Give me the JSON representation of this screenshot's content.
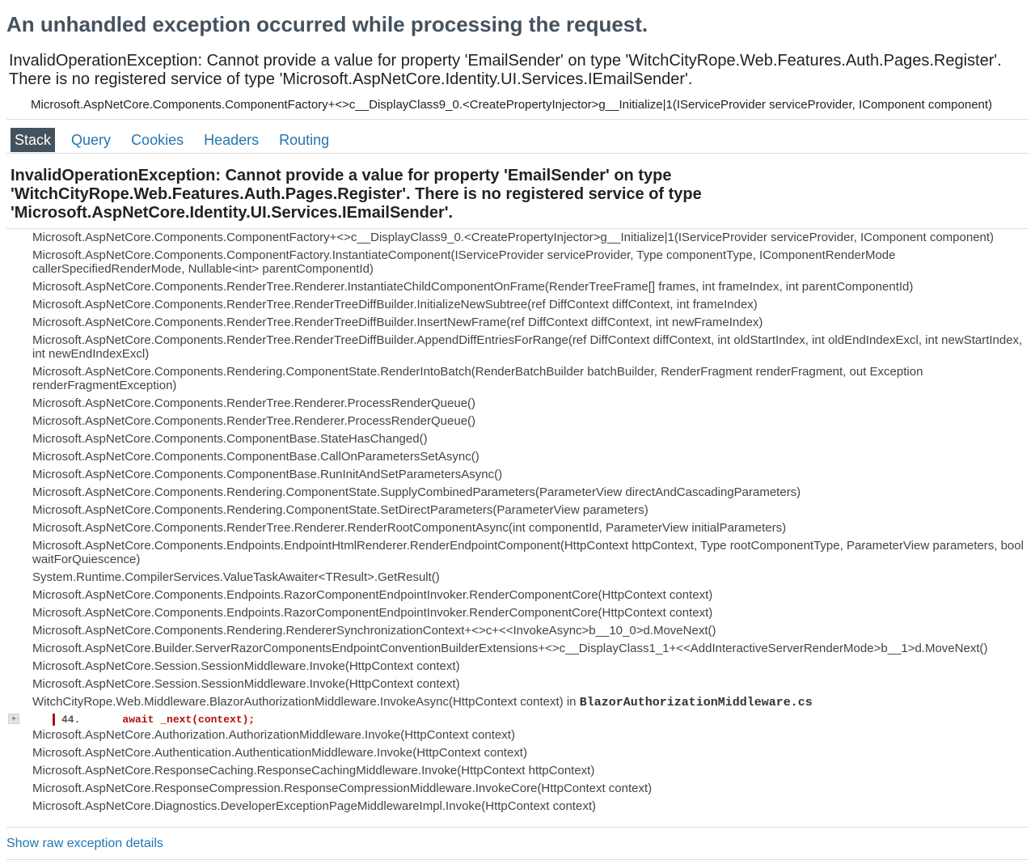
{
  "page_title": "An unhandled exception occurred while processing the request.",
  "error": {
    "title": "InvalidOperationException: Cannot provide a value for property 'EmailSender' on type 'WitchCityRope.Web.Features.Auth.Pages.Register'. There is no registered service of type 'Microsoft.AspNetCore.Identity.UI.Services.IEmailSender'.",
    "location": "Microsoft.AspNetCore.Components.ComponentFactory+<>c__DisplayClass9_0.<CreatePropertyInjector>g__Initialize|1(IServiceProvider serviceProvider, IComponent component)"
  },
  "tabs": [
    {
      "label": "Stack",
      "selected": true
    },
    {
      "label": "Query",
      "selected": false
    },
    {
      "label": "Cookies",
      "selected": false
    },
    {
      "label": "Headers",
      "selected": false
    },
    {
      "label": "Routing",
      "selected": false
    }
  ],
  "stack": {
    "exception_title": "InvalidOperationException: Cannot provide a value for property 'EmailSender' on type 'WitchCityRope.Web.Features.Auth.Pages.Register'. There is no registered service of type 'Microsoft.AspNetCore.Identity.UI.Services.IEmailSender'.",
    "frames": [
      "Microsoft.AspNetCore.Components.ComponentFactory+<>c__DisplayClass9_0.<CreatePropertyInjector>g__Initialize|1(IServiceProvider serviceProvider, IComponent component)",
      "Microsoft.AspNetCore.Components.ComponentFactory.InstantiateComponent(IServiceProvider serviceProvider, Type componentType, IComponentRenderMode callerSpecifiedRenderMode, Nullable<int> parentComponentId)",
      "Microsoft.AspNetCore.Components.RenderTree.Renderer.InstantiateChildComponentOnFrame(RenderTreeFrame[] frames, int frameIndex, int parentComponentId)",
      "Microsoft.AspNetCore.Components.RenderTree.RenderTreeDiffBuilder.InitializeNewSubtree(ref DiffContext diffContext, int frameIndex)",
      "Microsoft.AspNetCore.Components.RenderTree.RenderTreeDiffBuilder.InsertNewFrame(ref DiffContext diffContext, int newFrameIndex)",
      "Microsoft.AspNetCore.Components.RenderTree.RenderTreeDiffBuilder.AppendDiffEntriesForRange(ref DiffContext diffContext, int oldStartIndex, int oldEndIndexExcl, int newStartIndex, int newEndIndexExcl)",
      "Microsoft.AspNetCore.Components.Rendering.ComponentState.RenderIntoBatch(RenderBatchBuilder batchBuilder, RenderFragment renderFragment, out Exception renderFragmentException)",
      "Microsoft.AspNetCore.Components.RenderTree.Renderer.ProcessRenderQueue()",
      "Microsoft.AspNetCore.Components.RenderTree.Renderer.ProcessRenderQueue()",
      "Microsoft.AspNetCore.Components.ComponentBase.StateHasChanged()",
      "Microsoft.AspNetCore.Components.ComponentBase.CallOnParametersSetAsync()",
      "Microsoft.AspNetCore.Components.ComponentBase.RunInitAndSetParametersAsync()",
      "Microsoft.AspNetCore.Components.Rendering.ComponentState.SupplyCombinedParameters(ParameterView directAndCascadingParameters)",
      "Microsoft.AspNetCore.Components.Rendering.ComponentState.SetDirectParameters(ParameterView parameters)",
      "Microsoft.AspNetCore.Components.RenderTree.Renderer.RenderRootComponentAsync(int componentId, ParameterView initialParameters)",
      "Microsoft.AspNetCore.Components.Endpoints.EndpointHtmlRenderer.RenderEndpointComponent(HttpContext httpContext, Type rootComponentType, ParameterView parameters, bool waitForQuiescence)",
      "System.Runtime.CompilerServices.ValueTaskAwaiter<TResult>.GetResult()",
      "Microsoft.AspNetCore.Components.Endpoints.RazorComponentEndpointInvoker.RenderComponentCore(HttpContext context)",
      "Microsoft.AspNetCore.Components.Endpoints.RazorComponentEndpointInvoker.RenderComponentCore(HttpContext context)",
      "Microsoft.AspNetCore.Components.Rendering.RendererSynchronizationContext+<>c+<<InvokeAsync>b__10_0>d.MoveNext()",
      "Microsoft.AspNetCore.Builder.ServerRazorComponentsEndpointConventionBuilderExtensions+<>c__DisplayClass1_1+<<AddInteractiveServerRenderMode>b__1>d.MoveNext()",
      "Microsoft.AspNetCore.Session.SessionMiddleware.Invoke(HttpContext context)",
      "Microsoft.AspNetCore.Session.SessionMiddleware.Invoke(HttpContext context)"
    ],
    "source_frame": {
      "method": "WitchCityRope.Web.Middleware.BlazorAuthorizationMiddleware.InvokeAsync(HttpContext context) in ",
      "file": "BlazorAuthorizationMiddleware.cs",
      "expander": "+",
      "line_number": "44.",
      "code": "await _next(context);"
    },
    "frames_after": [
      "Microsoft.AspNetCore.Authorization.AuthorizationMiddleware.Invoke(HttpContext context)",
      "Microsoft.AspNetCore.Authentication.AuthenticationMiddleware.Invoke(HttpContext context)",
      "Microsoft.AspNetCore.ResponseCaching.ResponseCachingMiddleware.Invoke(HttpContext httpContext)",
      "Microsoft.AspNetCore.ResponseCompression.ResponseCompressionMiddleware.InvokeCore(HttpContext context)",
      "Microsoft.AspNetCore.Diagnostics.DeveloperExceptionPageMiddlewareImpl.Invoke(HttpContext context)"
    ]
  },
  "raw_link": "Show raw exception details",
  "colors": {
    "heading": "#44525e",
    "tab_selected_bg": "#44525e",
    "link": "#2376b1",
    "error_code": "#b01011"
  }
}
